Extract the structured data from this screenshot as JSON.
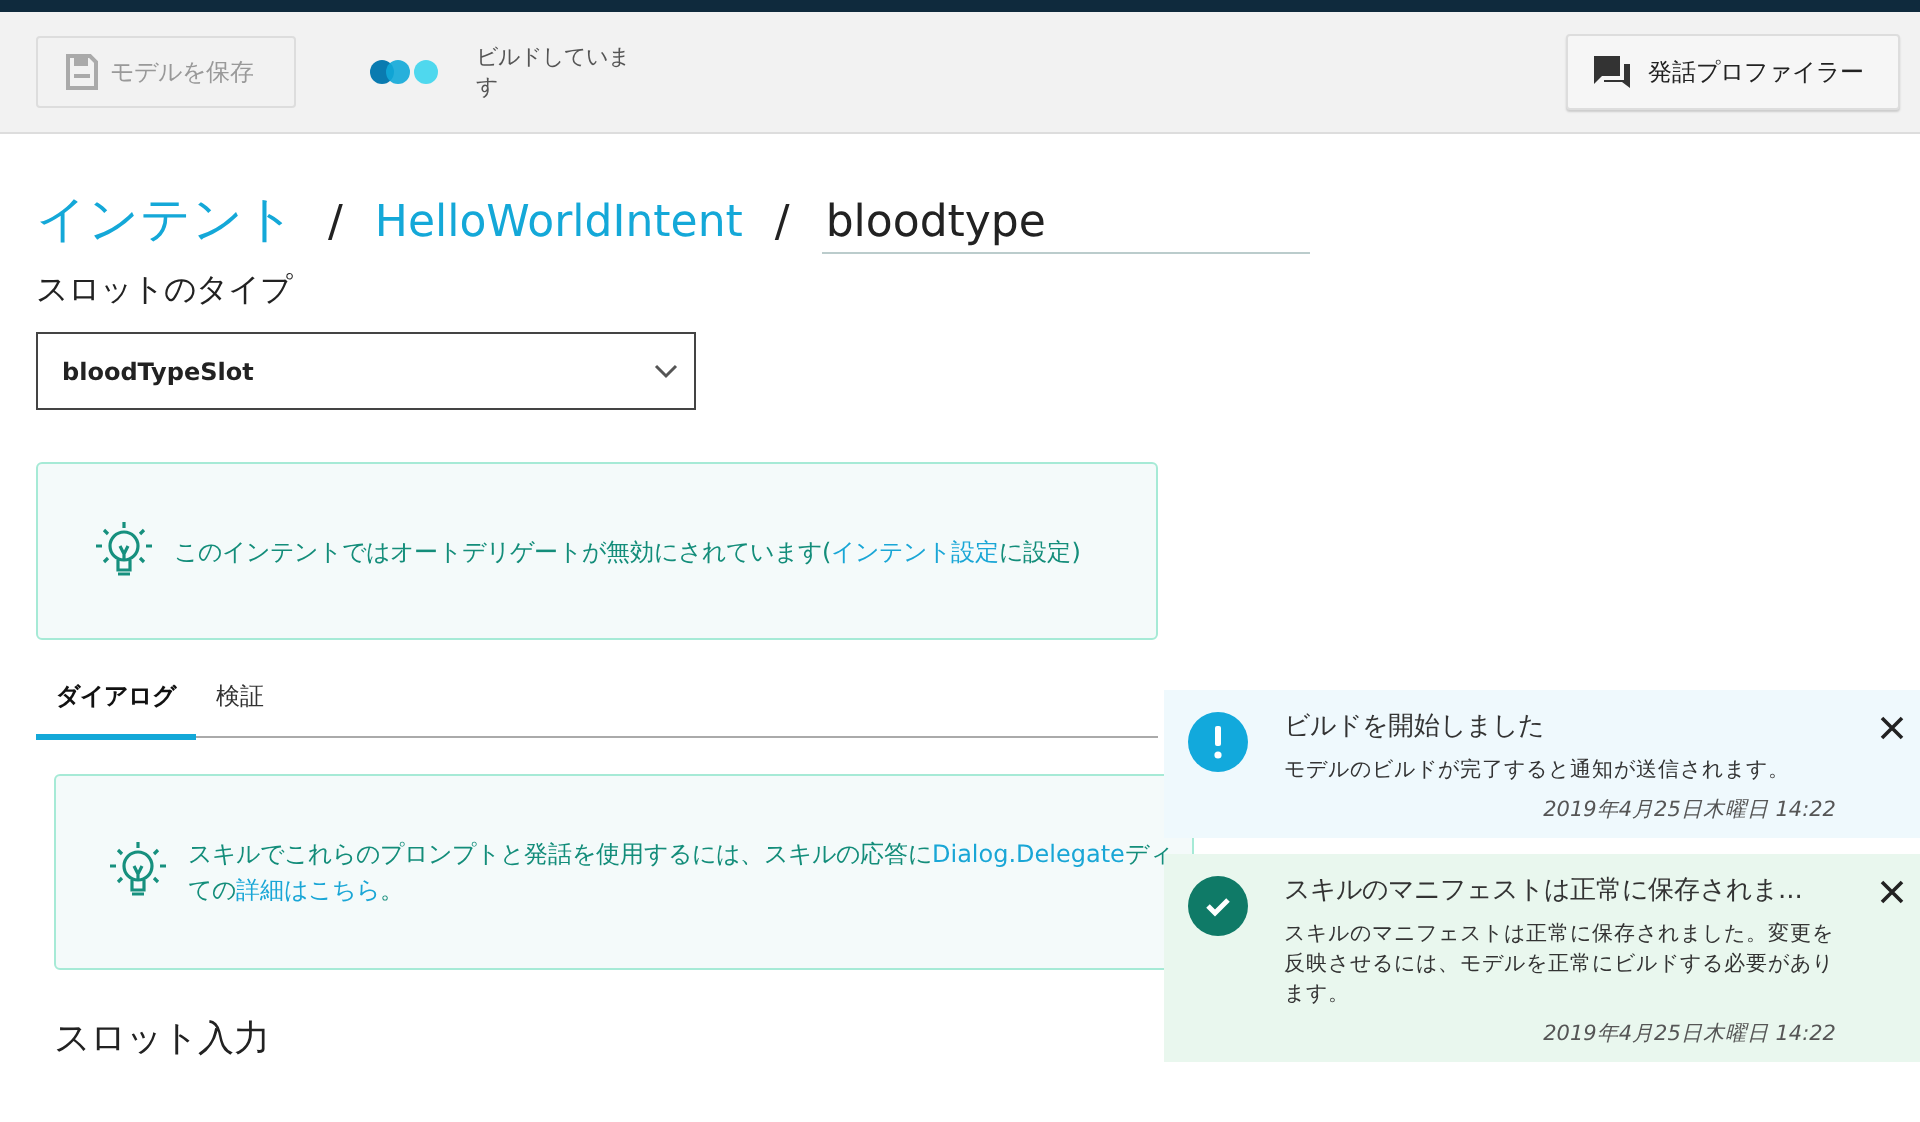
{
  "toolbar": {
    "save_button": {
      "label": "モデルを保存",
      "disabled": true
    },
    "build_status": "ビルドしています",
    "profiler_button": {
      "label": "発話プロファイラー"
    }
  },
  "breadcrumb": {
    "items": [
      "インテント",
      "HelloWorldIntent"
    ],
    "separator": "/",
    "slot_name": "bloodtype"
  },
  "slot_type": {
    "label": "スロットのタイプ",
    "value": "bloodTypeSlot"
  },
  "notice": {
    "segments": [
      {
        "text": "このインテントではオートデリゲートが無効にされています(",
        "link": false
      },
      {
        "text": "インテント設定",
        "link": true
      },
      {
        "text": "に設定)",
        "link": false
      }
    ]
  },
  "tabs": [
    {
      "label": "ダイアログ",
      "selected": true
    },
    {
      "label": "検証",
      "selected": false
    }
  ],
  "dialog_notice": {
    "lines": [
      {
        "segments": [
          {
            "text": "スキルでこれらのプロンプトと発話を使用するには、スキルの応答に",
            "link": false
          },
          {
            "text": "Dialog.Delegate",
            "link": true
          },
          {
            "text": "ディ",
            "link": false
          }
        ]
      },
      {
        "segments": [
          {
            "text": "ての",
            "link": false
          },
          {
            "text": "詳細はこちら",
            "link": true
          },
          {
            "text": "。",
            "link": false
          }
        ]
      }
    ]
  },
  "section_heading": "スロット入力",
  "toasts": [
    {
      "kind": "info",
      "title": "ビルドを開始しました",
      "message": "モデルのビルドが完了すると通知が送信されます。",
      "time": "2019年4月25日木曜日 14:22"
    },
    {
      "kind": "success",
      "title": "スキルのマニフェストは正常に保存されま...",
      "message": "スキルのマニフェストは正常に保存されました。変更を反映させるには、モデルを正常にビルドする必要があります。",
      "time": "2019年4月25日木曜日 14:22"
    }
  ]
}
